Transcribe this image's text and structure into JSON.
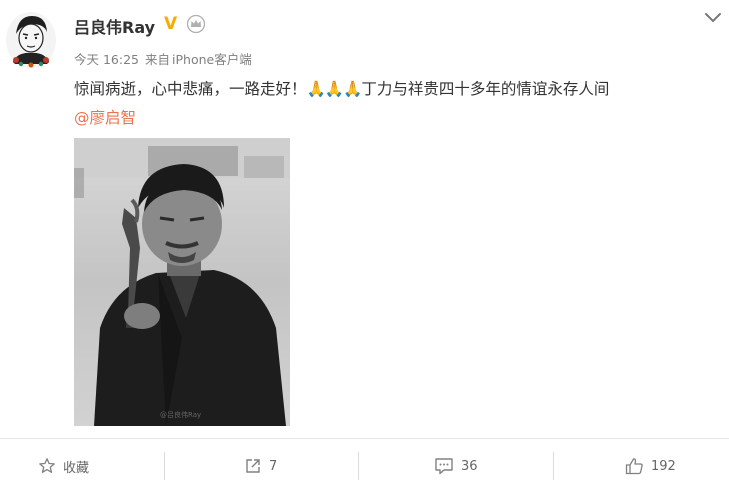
{
  "user": {
    "name": "吕良伟Ray",
    "verified_badge": "V",
    "verified_color": "#f6ab00"
  },
  "post": {
    "meta": {
      "time": "今天 16:25",
      "source_prefix": "来自",
      "source": "iPhone客户端"
    },
    "text_before": "惊闻病逝，心中悲痛，一路走好！",
    "emoji": "🙏🙏🙏",
    "text_after": "丁力与祥贵四十多年的情谊永存人间",
    "mention": "@廖启智",
    "mention_color": "#eb7350",
    "image_watermark": "@吕良伟Ray"
  },
  "actions": {
    "favorite": "收藏",
    "repost": "7",
    "comment": "36",
    "like": "192"
  },
  "icons": [
    "avatar",
    "crown-icon",
    "chevron-down-icon",
    "star-icon",
    "repost-icon",
    "comment-icon",
    "thumbs-up-icon"
  ]
}
